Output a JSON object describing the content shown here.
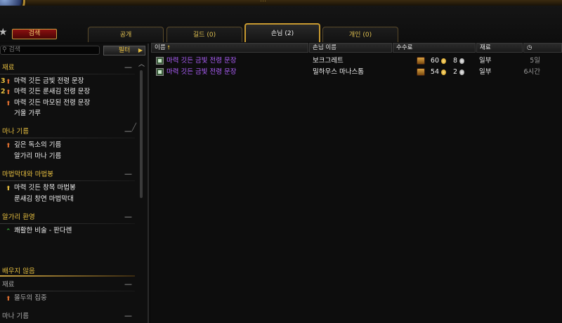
{
  "titlebar": {
    "text": "…"
  },
  "search_button": {
    "label": "검색"
  },
  "tabs": [
    {
      "label": "공개",
      "active": false
    },
    {
      "label": "길드 (0)",
      "active": false
    },
    {
      "label": "손님 (2)",
      "active": true
    },
    {
      "label": "개인 (0)",
      "active": false
    }
  ],
  "search": {
    "placeholder": "검색"
  },
  "filter": {
    "label": "필터"
  },
  "categories": [
    {
      "name": "재료",
      "recipes": [
        {
          "count": "3",
          "label": "마력 깃든 금빛 전령 문장"
        },
        {
          "count": "2",
          "label": "마력 깃든 룬새김 전령 문장"
        },
        {
          "count": "",
          "label": "마력 깃든 마모된 전령 문장"
        },
        {
          "count": "",
          "label": "거울 가루"
        }
      ]
    },
    {
      "name": "마나 기름",
      "recipes": [
        {
          "count": "",
          "label": "깊은 독소의 기름"
        },
        {
          "count": "",
          "label": "알가리 마나 기름"
        }
      ]
    },
    {
      "name": "마법막대와 마법봉",
      "recipes": [
        {
          "count": "",
          "label": "마력 깃든 창목 마법봉"
        },
        {
          "count": "",
          "label": "룬새김 창연 마법막대"
        }
      ]
    },
    {
      "name": "알가리 환영",
      "recipes": [
        {
          "count": "",
          "label": "쾌활한 비술 - 판다렌"
        }
      ]
    }
  ],
  "unlearned": {
    "title": "배우지 않음",
    "categories": [
      {
        "name": "재료",
        "recipes": [
          {
            "label": "몰두의 집중"
          }
        ]
      },
      {
        "name": "마나 기름"
      }
    ]
  },
  "columns": {
    "name": "이름",
    "customer": "손님 이름",
    "commission": "수수료",
    "reagents": "재료"
  },
  "orders": [
    {
      "name": "마력 깃든 금빛 전령 문장",
      "customer": "보크그레트",
      "gold": "60",
      "silver": "8",
      "reagents": "일부",
      "time": "5일"
    },
    {
      "name": "마력 깃든 금빛 전령 문장",
      "customer": "밀하우스 마나스톰",
      "gold": "54",
      "silver": "2",
      "reagents": "일부",
      "time": "6시간"
    }
  ],
  "colors": {
    "gold_text": "#e8c040",
    "recipe_epic": "#b060ff",
    "tab_border": "#c89a30"
  }
}
